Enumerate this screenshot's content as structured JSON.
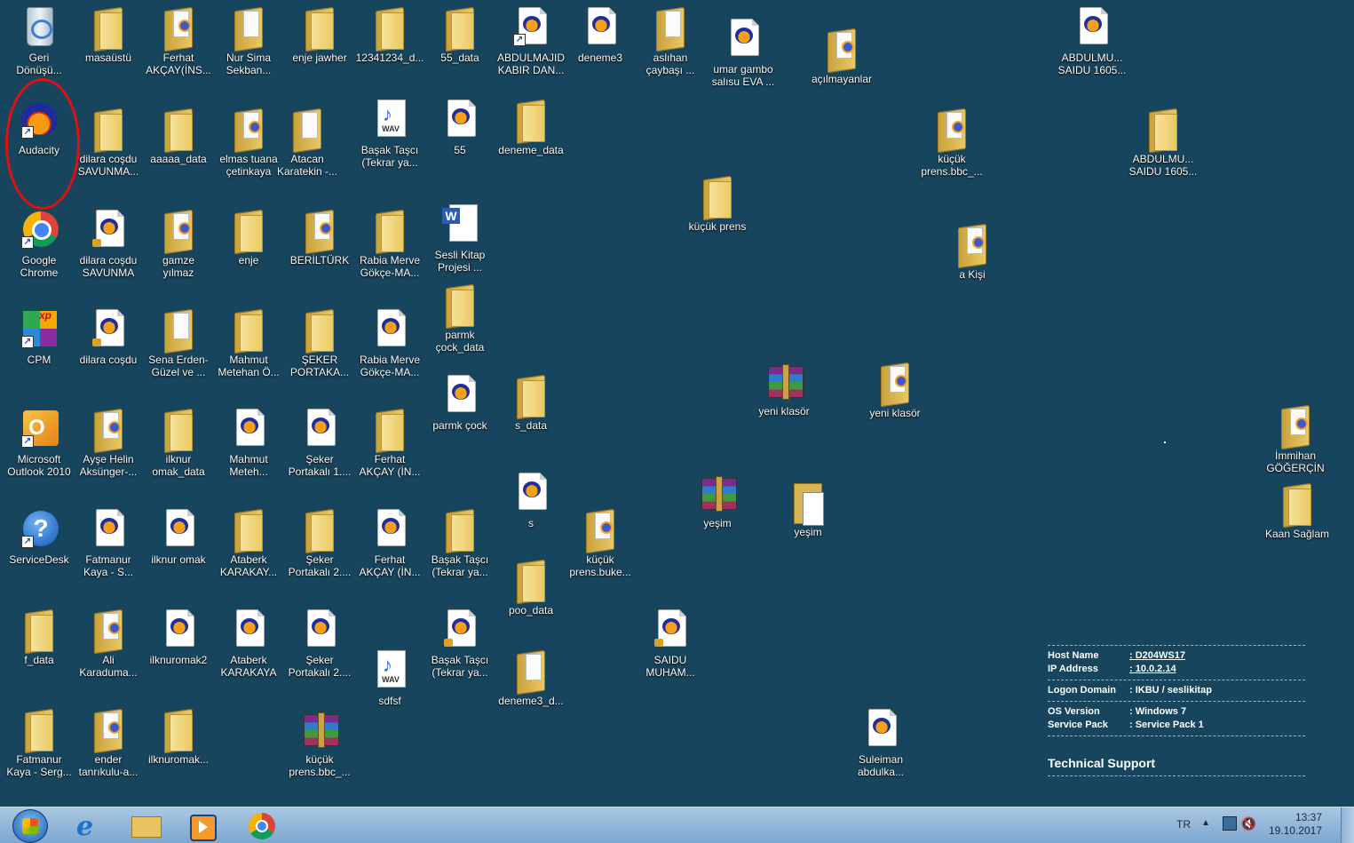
{
  "desktop": {
    "icons": [
      {
        "label": "Geri\nDönüşü...",
        "type": "recycle"
      },
      {
        "label": "masaüstü",
        "type": "folder"
      },
      {
        "label": "Ferhat\nAKÇAY(İNS...",
        "type": "folder"
      },
      {
        "label": "Nur Sima\nSekban...",
        "type": "folder"
      },
      {
        "label": "enje jawher",
        "type": "folder"
      },
      {
        "label": "12341234_d...",
        "type": "folder"
      },
      {
        "label": "55_data",
        "type": "folder"
      },
      {
        "label": "ABDULMAJID\nKABIR DAN...",
        "type": "audio"
      },
      {
        "label": "deneme3",
        "type": "audio"
      },
      {
        "label": "aslıhan\nçaybaşı ...",
        "type": "folder"
      },
      {
        "label": "umar gambo\nsalısu EVA ...",
        "type": "audio"
      },
      {
        "label": "açılmayanlar",
        "type": "folder"
      },
      {
        "label": "ABDULMU...\nSAIDU 1605...",
        "type": "audio"
      },
      {
        "label": "Audacity",
        "type": "audacity"
      },
      {
        "label": "dilara coşdu\nSAVUNMA...",
        "type": "folder"
      },
      {
        "label": "aaaaa_data",
        "type": "folder"
      },
      {
        "label": "elmas tuana\nçetinkaya",
        "type": "folder"
      },
      {
        "label": "Atacan\nKaratekin -...",
        "type": "folder"
      },
      {
        "label": "Başak Taşcı\n(Tekrar ya...",
        "type": "wav"
      },
      {
        "label": "55",
        "type": "audio"
      },
      {
        "label": "deneme_data",
        "type": "folder"
      },
      {
        "label": "küçük\nprens.bbc_...",
        "type": "folder"
      },
      {
        "label": "ABDULMU...\nSAIDU 1605...",
        "type": "folder"
      },
      {
        "label": "küçük prens",
        "type": "folder"
      },
      {
        "label": "Google\nChrome",
        "type": "chrome"
      },
      {
        "label": "dilara coşdu\nSAVUNMA",
        "type": "audio"
      },
      {
        "label": "gamze\nyılmaz",
        "type": "folder"
      },
      {
        "label": "enje",
        "type": "folder"
      },
      {
        "label": "BERİLTÜRK",
        "type": "folder"
      },
      {
        "label": "Rabia Merve\nGökçe-MA...",
        "type": "folder"
      },
      {
        "label": "Sesli Kitap\nProjesi ...",
        "type": "word"
      },
      {
        "label": "a Kişi",
        "type": "folder"
      },
      {
        "label": "parmk\nçock_data",
        "type": "folder"
      },
      {
        "label": "CPM",
        "type": "cpm"
      },
      {
        "label": "dilara coşdu",
        "type": "audio"
      },
      {
        "label": "Sena Erden-\nGüzel ve ...",
        "type": "folder"
      },
      {
        "label": "Mahmut\nMetehan Ö...",
        "type": "folder"
      },
      {
        "label": "ŞEKER\nPORTAKA...",
        "type": "folder"
      },
      {
        "label": "Rabia Merve\nGökçe-MA...",
        "type": "audio"
      },
      {
        "label": "yeni klasör",
        "type": "rar"
      },
      {
        "label": "yeni klasör",
        "type": "folder"
      },
      {
        "label": "parmk çock",
        "type": "audio"
      },
      {
        "label": "s_data",
        "type": "folder"
      },
      {
        "label": "Microsoft\nOutlook 2010",
        "type": "outlook"
      },
      {
        "label": "Ayşe Helin\nAksünger-...",
        "type": "folder"
      },
      {
        "label": "ilknur\nomak_data",
        "type": "folder"
      },
      {
        "label": "Mahmut\nMeteh...",
        "type": "audio"
      },
      {
        "label": "Şeker\nPortakalı 1....",
        "type": "audio"
      },
      {
        "label": "Ferhat\nAKÇAY (İN...",
        "type": "folder"
      },
      {
        "label": "İmmihan\nGÖĞERÇİN",
        "type": "folder"
      },
      {
        "label": "s",
        "type": "audio"
      },
      {
        "label": "yeşim",
        "type": "rar"
      },
      {
        "label": "yeşim",
        "type": "open"
      },
      {
        "label": "Kaan Sağlam",
        "type": "folder"
      },
      {
        "label": "ServiceDesk",
        "type": "help"
      },
      {
        "label": "Fatmanur\nKaya - S...",
        "type": "audio"
      },
      {
        "label": "ilknur omak",
        "type": "audio"
      },
      {
        "label": "Ataberk\nKARAKAY...",
        "type": "folder"
      },
      {
        "label": "Şeker\nPortakalı 2....",
        "type": "folder"
      },
      {
        "label": "Ferhat\nAKÇAY (İN...",
        "type": "audio"
      },
      {
        "label": "Başak Taşcı\n(Tekrar ya...",
        "type": "folder"
      },
      {
        "label": "küçük\nprens.buke...",
        "type": "folder"
      },
      {
        "label": "poo_data",
        "type": "folder"
      },
      {
        "label": "f_data",
        "type": "folder"
      },
      {
        "label": "Ali\nKaraduma...",
        "type": "folder"
      },
      {
        "label": "ilknuromak2",
        "type": "audio"
      },
      {
        "label": "Ataberk\nKARAKAYA",
        "type": "audio"
      },
      {
        "label": "Şeker\nPortakalı 2....",
        "type": "audio"
      },
      {
        "label": "sdfsf",
        "type": "wav"
      },
      {
        "label": "Başak Taşcı\n(Tekrar ya...",
        "type": "audio"
      },
      {
        "label": "deneme3_d...",
        "type": "folder"
      },
      {
        "label": "SAIDU\nMUHAM...",
        "type": "audio"
      },
      {
        "label": "Fatmanur\nKaya - Serg...",
        "type": "folder"
      },
      {
        "label": "ender\ntanrıkulu-a...",
        "type": "folder"
      },
      {
        "label": "ilknuromak...",
        "type": "folder"
      },
      {
        "label": "küçük\nprens.bbc_...",
        "type": "rar"
      },
      {
        "label": "Suleiman\nabdulka...",
        "type": "audio"
      }
    ]
  },
  "bginfo": {
    "host_name_label": "Host Name",
    "host_name_value": ": D204WS17",
    "ip_label": "IP Address",
    "ip_value": ": 10.0.2.14",
    "logon_label": "Logon Domain",
    "logon_value": ": IKBU / seslikitap",
    "os_label": "OS Version",
    "os_value": ": Windows 7",
    "sp_label": "Service Pack",
    "sp_value": ": Service Pack 1",
    "support_title": "Technical Support"
  },
  "taskbar": {
    "lang": "TR",
    "time": "13:37",
    "date": "19.10.2017"
  },
  "colors": {
    "desktop": "#17455e",
    "taskbar": "#8fb4d8",
    "highlight_circle": "#e01010"
  }
}
